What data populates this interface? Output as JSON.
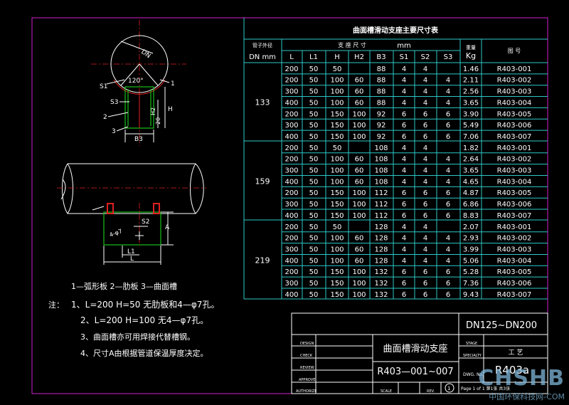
{
  "colors": {
    "background": "#000000",
    "table_lines": "#2ec8c8",
    "text": "#ffffff",
    "frame": "#d020d0",
    "support": "#18c018",
    "pipe_accent": "#e02020"
  },
  "table": {
    "title": "曲面槽滑动支座主要尺寸表",
    "hdr_pipe_label": "管子外径",
    "hdr_dn": "DN  mm",
    "hdr_dims_group": "支 座 尺 寸",
    "hdr_dims_unit": "mm",
    "hdr_weight_label": "重量",
    "hdr_weight_unit": "Kg",
    "hdr_drawing": "图    号",
    "columns": [
      "L",
      "L1",
      "H",
      "H2",
      "B3",
      "S1",
      "S2",
      "S3"
    ],
    "groups": [
      {
        "dn": "133",
        "rows": [
          [
            "200",
            "50",
            "50",
            "",
            "88",
            "4",
            "4",
            "",
            "1.46",
            "R403-001"
          ],
          [
            "200",
            "50",
            "100",
            "60",
            "88",
            "4",
            "4",
            "4",
            "2.11",
            "R403-002"
          ],
          [
            "300",
            "50",
            "100",
            "60",
            "88",
            "4",
            "4",
            "4",
            "2.56",
            "R403-003"
          ],
          [
            "400",
            "50",
            "100",
            "60",
            "88",
            "4",
            "4",
            "4",
            "3.65",
            "R403-004"
          ],
          [
            "200",
            "50",
            "150",
            "100",
            "92",
            "6",
            "6",
            "6",
            "3.90",
            "R403-005"
          ],
          [
            "300",
            "50",
            "150",
            "100",
            "92",
            "6",
            "6",
            "6",
            "5.49",
            "R403-006"
          ],
          [
            "400",
            "50",
            "150",
            "100",
            "92",
            "6",
            "6",
            "6",
            "7.06",
            "R403-007"
          ]
        ]
      },
      {
        "dn": "159",
        "rows": [
          [
            "200",
            "50",
            "50",
            "",
            "108",
            "4",
            "4",
            "",
            "1.82",
            "R403-001"
          ],
          [
            "200",
            "50",
            "100",
            "60",
            "108",
            "4",
            "4",
            "4",
            "2.64",
            "R403-002"
          ],
          [
            "300",
            "50",
            "100",
            "60",
            "108",
            "4",
            "4",
            "4",
            "3.65",
            "R403-003"
          ],
          [
            "400",
            "50",
            "100",
            "60",
            "108",
            "4",
            "4",
            "4",
            "4.65",
            "R403-004"
          ],
          [
            "200",
            "50",
            "150",
            "100",
            "112",
            "6",
            "6",
            "6",
            "4.87",
            "R403-005"
          ],
          [
            "300",
            "50",
            "150",
            "100",
            "112",
            "6",
            "6",
            "6",
            "6.86",
            "R403-006"
          ],
          [
            "400",
            "50",
            "150",
            "100",
            "112",
            "6",
            "6",
            "6",
            "8.83",
            "R403-007"
          ]
        ]
      },
      {
        "dn": "219",
        "rows": [
          [
            "200",
            "50",
            "50",
            "",
            "128",
            "4",
            "4",
            "",
            "2.07",
            "R403-001"
          ],
          [
            "200",
            "50",
            "100",
            "60",
            "128",
            "4",
            "4",
            "4",
            "2.93",
            "R403-002"
          ],
          [
            "300",
            "50",
            "100",
            "60",
            "128",
            "4",
            "4",
            "4",
            "3.99",
            "R403-003"
          ],
          [
            "400",
            "50",
            "100",
            "60",
            "128",
            "4",
            "4",
            "4",
            "5.06",
            "R403-004"
          ],
          [
            "200",
            "50",
            "150",
            "100",
            "132",
            "6",
            "6",
            "6",
            "5.28",
            "R403-005"
          ],
          [
            "300",
            "50",
            "150",
            "100",
            "132",
            "6",
            "6",
            "6",
            "7.36",
            "R403-006"
          ],
          [
            "400",
            "50",
            "150",
            "100",
            "132",
            "6",
            "6",
            "6",
            "9.43",
            "R403-007"
          ]
        ]
      }
    ]
  },
  "drawing": {
    "top_labels": {
      "dn": "DN",
      "s1": "S1",
      "angle": "120°",
      "b3": "B3",
      "s3": "S3",
      "h2": "H2",
      "h": "H",
      "s20": "20",
      "c1": "1",
      "c2": "2",
      "c3": "3"
    },
    "side_labels": {
      "a": "A",
      "s2": "S2",
      "a47": "4-φ7",
      "l1": "L1",
      "l": "L"
    }
  },
  "legend": "1—弧形板  2—肋板  3—曲面槽",
  "notes": {
    "prefix": "注：",
    "n1": "1、L=200  H=50  无肋板和4—φ7孔。",
    "n2": "2、L=200  H=100  无4—φ7孔。",
    "n3": "3、曲面槽亦可用焊接代替槽钢。",
    "n4": "4、尺寸A由根据管道保温厚度决定。"
  },
  "title_block": {
    "range": "DN125~DN200",
    "name": "曲面槽滑动支座",
    "code": "R403—001~007",
    "dwg_no": "R403a",
    "craft": "工    艺",
    "design": "DESIGN",
    "check": "CHECK",
    "review": "REVIEW",
    "approve": "APPROVE",
    "authorize": "AUTHORIZE",
    "stage": "STAGE",
    "specialty": "SPECIALTY",
    "dwg_label": "DWG. No.",
    "scale": "SCALE",
    "rev": "REV.",
    "scale_value": "1",
    "page": "Page 1 of 1  第1张  共3张"
  },
  "watermark": {
    "logo": "CHSHB",
    "site": "中国环保科技网-COM"
  }
}
